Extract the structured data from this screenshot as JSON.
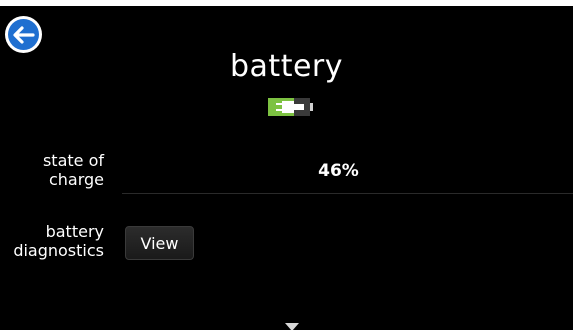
{
  "header": {
    "title": "battery",
    "back_icon": "back-arrow-icon",
    "battery_icon": "battery-plug-icon"
  },
  "rows": [
    {
      "label_line1": "state of",
      "label_line2": "charge",
      "value": "46%"
    },
    {
      "label_line1": "battery",
      "label_line2": "diagnostics",
      "button_label": "View"
    }
  ],
  "footer": {
    "scroll_icon": "scroll-down-icon"
  },
  "colors": {
    "background": "#000000",
    "back_button": "#1f6fd0",
    "battery_green": "#7dc242",
    "text": "#ffffff"
  },
  "battery": {
    "charge_percent": 46
  }
}
